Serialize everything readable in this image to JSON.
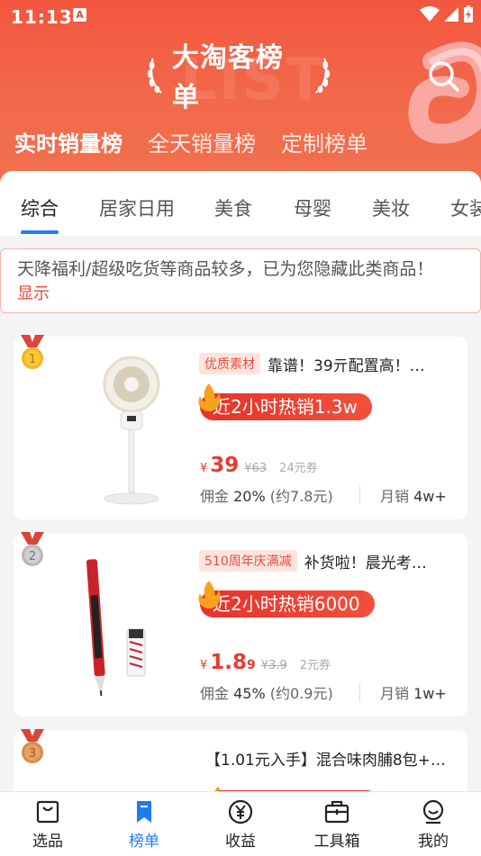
{
  "status": {
    "time": "11:13",
    "app_badge": "A"
  },
  "header": {
    "title": "大淘客榜单",
    "watermark": "LIST",
    "tabs": [
      {
        "label": "实时销量榜",
        "active": true
      },
      {
        "label": "全天销量榜",
        "active": false
      },
      {
        "label": "定制榜单",
        "active": false
      }
    ]
  },
  "categories": [
    "综合",
    "居家日用",
    "美食",
    "母婴",
    "美妆",
    "女装"
  ],
  "notice": {
    "text": "天降福利/超级吃货等商品较多，已为您隐藏此类商品！",
    "link": "显示"
  },
  "products": [
    {
      "rank": "1",
      "badge": "优质素材",
      "title": "靠谱！39亓配置高！…",
      "hot": "近2小时热销1.3w",
      "price_symbol": "¥",
      "price_main": "39",
      "price_dec": "",
      "price_orig": "¥63",
      "coupon": "24元券",
      "commission_label": "佣金",
      "commission_rate": "20%",
      "commission_amount": "(约7.8元)",
      "monthly_label": "月销",
      "monthly_value": "4w+"
    },
    {
      "rank": "2",
      "badge": "510周年庆满减",
      "title": "补货啦！晨光考…",
      "hot": "近2小时热销6000",
      "price_symbol": "¥",
      "price_main": "1.8",
      "price_dec": "9",
      "price_orig": "¥3.9",
      "coupon": "2元券",
      "commission_label": "佣金",
      "commission_rate": "45%",
      "commission_amount": "(约0.9元)",
      "monthly_label": "月销",
      "monthly_value": "1w+"
    },
    {
      "rank": "3",
      "title": "【1.01元入手】混合味肉脯8包+…"
    }
  ],
  "bottom_nav": [
    {
      "label": "选品",
      "icon": "bag-icon",
      "active": false
    },
    {
      "label": "榜单",
      "icon": "bookmark-icon",
      "active": true
    },
    {
      "label": "收益",
      "icon": "yuan-icon",
      "active": false
    },
    {
      "label": "工具箱",
      "icon": "toolbox-icon",
      "active": false
    },
    {
      "label": "我的",
      "icon": "profile-icon",
      "active": false
    }
  ],
  "colors": {
    "header": "#f3563f",
    "accent_blue": "#1e7cf2",
    "price_red": "#e83b2e"
  }
}
